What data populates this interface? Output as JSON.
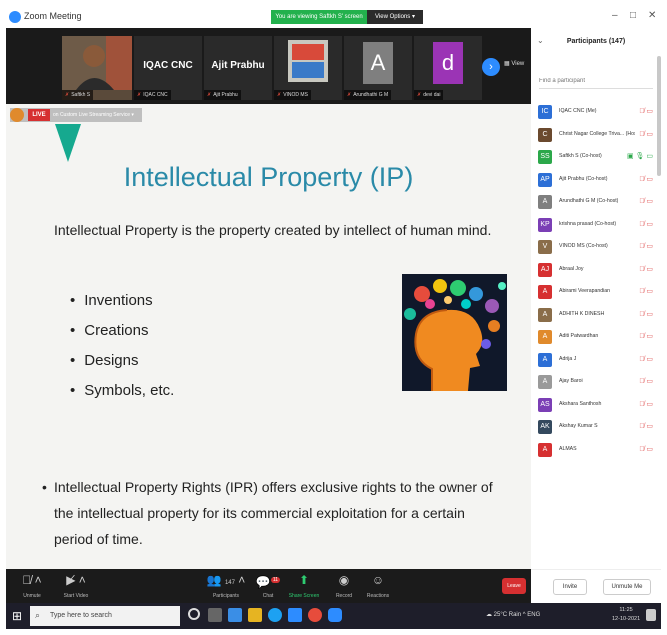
{
  "window": {
    "title": "Zoom Meeting",
    "viewing_banner": "You are viewing Saftkh S' screen",
    "view_options": "View Options ▾",
    "controls": [
      "–",
      "□",
      "✕"
    ]
  },
  "video_strip": {
    "tiles": [
      {
        "name": "Saftkh S",
        "kind": "video"
      },
      {
        "big_name": "IQAC CNC",
        "name": "IQAC CNC",
        "kind": "name"
      },
      {
        "big_name": "Ajit Prabhu",
        "name": "Ajit Prabhu",
        "kind": "name"
      },
      {
        "name": "VINOD MS",
        "kind": "image"
      },
      {
        "letter": "A",
        "name": "Arundhathi G M",
        "kind": "letter",
        "color": "#7f7f7f"
      },
      {
        "letter": "d",
        "name": "devi dai",
        "kind": "letter",
        "color": "#9b34b5"
      }
    ],
    "view_label": "View"
  },
  "live": {
    "badge": "LIVE",
    "text": "on Custom Live Streaming Service ▾"
  },
  "slide": {
    "title": "Intellectual Property (IP)",
    "definition": "Intellectual Property is the property created by intellect of human mind.",
    "bullets": [
      "Inventions",
      "Creations",
      "Designs",
      "Symbols, etc."
    ],
    "ipr": "Intellectual Property Rights (IPR) offers exclusive rights to the owner of the intellectual property for its commercial exploitation for a certain period of time."
  },
  "participants": {
    "title": "Participants (147)",
    "search_placeholder": "Find a participant",
    "items": [
      {
        "initials": "IC",
        "name": "IQAC CNC (Me)",
        "color": "#2d6fd6"
      },
      {
        "initials": "C",
        "name": "Christ Nagar College Triva... (Host)",
        "color": "#6b4a2f"
      },
      {
        "initials": "SS",
        "name": "Saftkh S (Co-host)",
        "color": "#2ba84a"
      },
      {
        "initials": "AP",
        "name": "Ajit Prabhu (Co-host)",
        "color": "#2d6fd6"
      },
      {
        "initials": "A",
        "name": "Arundhathi G M (Co-host)",
        "color": "#7f7f7f"
      },
      {
        "initials": "KP",
        "name": "krishna prasad (Co-host)",
        "color": "#7b3fb5"
      },
      {
        "initials": "V",
        "name": "VINOD MS (Co-host)",
        "color": "#8a6d4a"
      },
      {
        "initials": "AJ",
        "name": "Abraal Joy",
        "color": "#d63031"
      },
      {
        "initials": "A",
        "name": "Abirami Veerapandian",
        "color": "#d63031"
      },
      {
        "initials": "A",
        "name": "ADHITH K DINESH",
        "color": "#8a6d4a"
      },
      {
        "initials": "A",
        "name": "Aditi Patwardhan",
        "color": "#e08a2c"
      },
      {
        "initials": "A",
        "name": "Adrija J",
        "color": "#2d6fd6"
      },
      {
        "initials": "A",
        "name": "Ajay Baroi",
        "color": "#9a9a9a"
      },
      {
        "initials": "AS",
        "name": "Akshara Santhosh",
        "color": "#7b3fb5"
      },
      {
        "initials": "AK",
        "name": "Akshay Kumar S",
        "color": "#34495e"
      },
      {
        "initials": "A",
        "name": "ALMAS",
        "color": "#d63031"
      }
    ],
    "invite_label": "Invite",
    "unmute_me_label": "Unmute Me"
  },
  "toolbar": {
    "unmute": "Unmute",
    "start_video": "Start Video",
    "participants": "Participants",
    "participants_count": "147",
    "chat": "Chat",
    "chat_badge": "11",
    "share_screen": "Share Screen",
    "record": "Record",
    "reactions": "Reactions",
    "leave": "Leave"
  },
  "taskbar": {
    "search_placeholder": "Type here to search",
    "tray": "☁ 25°C Rain  ^  ENG",
    "time": "11:25",
    "date": "12-10-2021"
  }
}
